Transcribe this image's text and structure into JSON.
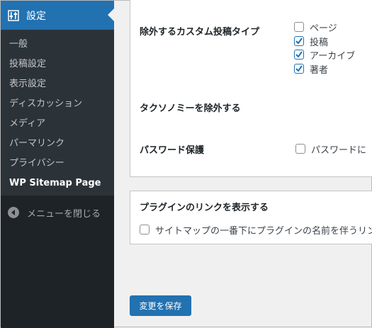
{
  "sidebar": {
    "header_label": "設定",
    "header_icon": "settings-sliders-icon",
    "items": [
      {
        "label": "一般"
      },
      {
        "label": "投稿設定"
      },
      {
        "label": "表示設定"
      },
      {
        "label": "ディスカッション"
      },
      {
        "label": "メディア"
      },
      {
        "label": "パーマリンク"
      },
      {
        "label": "プライバシー"
      },
      {
        "label": "WP Sitemap Page"
      }
    ],
    "collapse_label": "メニューを閉じる",
    "colors": {
      "bg": "#1d2327",
      "submenu_bg": "#2c3338",
      "accent": "#2271b1"
    }
  },
  "settings": {
    "exclude_post_types": {
      "label": "除外するカスタム投稿タイプ",
      "options": [
        {
          "label": "ページ",
          "checked": false
        },
        {
          "label": "投稿",
          "checked": true
        },
        {
          "label": "アーカイブ",
          "checked": true
        },
        {
          "label": "著者",
          "checked": true
        }
      ]
    },
    "exclude_taxonomies": {
      "label": "タクソノミーを除外する"
    },
    "password_protection": {
      "label": "パスワード保護",
      "option_label": "パスワードに",
      "checked": false
    }
  },
  "plugin_link": {
    "title": "プラグインのリンクを表示する",
    "option_label": "サイトマップの一番下にプラグインの名前を伴うリン",
    "checked": false
  },
  "save_button_label": "変更を保存"
}
